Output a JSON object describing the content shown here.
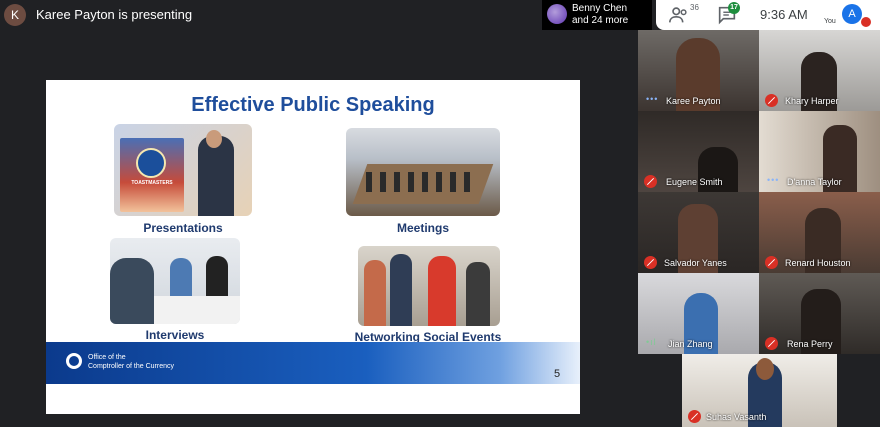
{
  "header": {
    "presenter_initial": "K",
    "presenting_text": "Karee Payton is presenting",
    "others_line1": "Benny Chen",
    "others_line2": "and 24 more",
    "people_count": "36",
    "chat_count": "17",
    "clock": "9:36 AM",
    "self_initial": "A",
    "self_label": "You"
  },
  "slide": {
    "title": "Effective Public Speaking",
    "captions": [
      "Presentations",
      "Meetings",
      "Interviews",
      "Networking Social Events"
    ],
    "org_line1": "Office of the",
    "org_line2": "Comptroller of the Currency",
    "page_number": "5",
    "banner_text": "TOASTMASTERS"
  },
  "participants": [
    {
      "name": "Karee Payton",
      "mic": "speaking"
    },
    {
      "name": "Khary Harper",
      "mic": "off"
    },
    {
      "name": "Eugene Smith",
      "mic": "off"
    },
    {
      "name": "D'anna Taylor",
      "mic": "speaking"
    },
    {
      "name": "Salvador Yanes",
      "mic": "off"
    },
    {
      "name": "Renard Houston",
      "mic": "off"
    },
    {
      "name": "Jian Zhang",
      "mic": "speaking"
    },
    {
      "name": "Rena Perry",
      "mic": "off"
    },
    {
      "name": "Suhas Vasanth",
      "mic": "off"
    }
  ],
  "colors": {
    "accent": "#1a73e8",
    "mic_off": "#d93025",
    "title_blue": "#1f4e9c"
  }
}
